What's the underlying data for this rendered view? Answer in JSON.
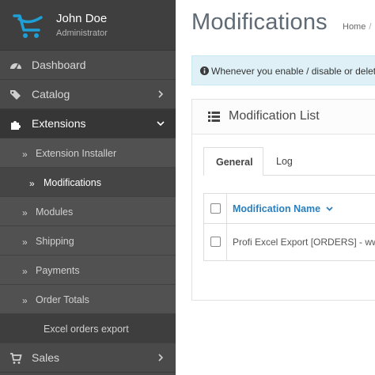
{
  "profile": {
    "name": "John Doe",
    "role": "Administrator"
  },
  "sidebar": {
    "items": [
      {
        "label": "Dashboard",
        "icon": "dashboard-icon"
      },
      {
        "label": "Catalog",
        "icon": "tag-icon"
      },
      {
        "label": "Extensions",
        "icon": "puzzle-icon"
      }
    ],
    "sub_items": [
      {
        "label": "Extension Installer"
      },
      {
        "label": "Modifications"
      },
      {
        "label": "Modules"
      },
      {
        "label": "Shipping"
      },
      {
        "label": "Payments"
      },
      {
        "label": "Order Totals"
      },
      {
        "label": "Excel orders export"
      }
    ],
    "bottom_item": {
      "label": "Sales",
      "icon": "cart-icon"
    },
    "sub_arrow": "»"
  },
  "main": {
    "title": "Modifications",
    "breadcrumb": {
      "home": "Home",
      "sep": "/"
    },
    "alert": {
      "text": "Whenever you enable / disable or delete"
    },
    "panel": {
      "title": "Modification List",
      "tabs": [
        {
          "label": "General"
        },
        {
          "label": "Log"
        }
      ],
      "table": {
        "header": "Modification Name",
        "rows": [
          {
            "name": "Profi Excel Export [ORDERS] - www"
          }
        ]
      }
    }
  },
  "colors": {
    "sidebar_bg": "#4a4a4a",
    "logo_blue": "#1ea0d6",
    "link_blue": "#2a7fbd",
    "alert_bg": "#dff1f7"
  }
}
